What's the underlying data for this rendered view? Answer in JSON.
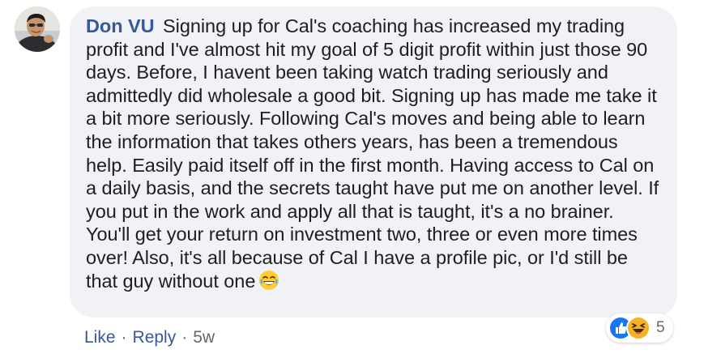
{
  "comment": {
    "author": "Don VU",
    "text": "Signing up for Cal's coaching has increased my trading profit and I've almost hit my goal of 5 digit profit within just those 90 days. Before, I havent been taking watch trading seriously and admittedly did wholesale a good bit. Signing up has made me take it a bit more seriously. Following Cal's moves and being able to learn the information that takes others years, has been a tremendous help. Easily paid itself off in the first month. Having access to Cal on a daily basis, and the secrets taught have put me on another level. If you put in the work and apply all that is taught, it's a no brainer. You'll get your return on investment two, three or even more times over! Also, it's all because of Cal I have a profile pic, or I'd still be that guy without one",
    "trailing_emoji": "laughing-tears-emoji",
    "avatar": "user-avatar-photo"
  },
  "reactions": {
    "icons": [
      "like-icon",
      "haha-icon"
    ],
    "count": "5",
    "like_color": "#1877f2",
    "haha_color": "#f7b125"
  },
  "actions": {
    "like_label": "Like",
    "reply_label": "Reply",
    "separator": "·",
    "timestamp": "5w"
  },
  "colors": {
    "bubble_bg": "#f0f2f5",
    "author": "#385898",
    "text": "#1c1e21",
    "meta": "#65676b"
  }
}
